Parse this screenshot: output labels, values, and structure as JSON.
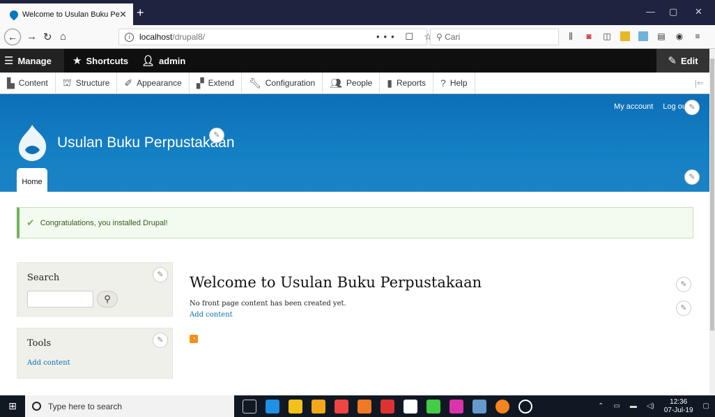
{
  "browser": {
    "tab_title": "Welcome to Usulan Buku Perpu",
    "url_host": "localhost",
    "url_path": "/drupal8/",
    "search_placeholder": "Cari",
    "url_actions": "••• ☐ ☆"
  },
  "toolbar": {
    "manage": "Manage",
    "shortcuts": "Shortcuts",
    "user": "admin",
    "edit": "Edit"
  },
  "tray": {
    "items": [
      "Content",
      "Structure",
      "Appearance",
      "Extend",
      "Configuration",
      "People",
      "Reports",
      "Help"
    ]
  },
  "header": {
    "my_account": "My account",
    "logout": "Log out",
    "site_name": "Usulan Buku Perpustakaan",
    "home_tab": "Home"
  },
  "message": {
    "text": "Congratulations, you installed Drupal!"
  },
  "sidebar": {
    "search_title": "Search",
    "tools_title": "Tools",
    "tools_link": "Add content"
  },
  "main": {
    "title": "Welcome to Usulan Buku Perpustakaan",
    "text": "No front page content has been created yet.",
    "link": "Add content"
  },
  "taskbar": {
    "search_placeholder": "Type here to search",
    "time": "12:36",
    "date": "07-Jul-19"
  },
  "colors": {
    "header_blue": "#0d6fb7",
    "toolbar_dark": "#0f0f0f",
    "message_green": "#77b259",
    "link_blue": "#0071b3"
  }
}
